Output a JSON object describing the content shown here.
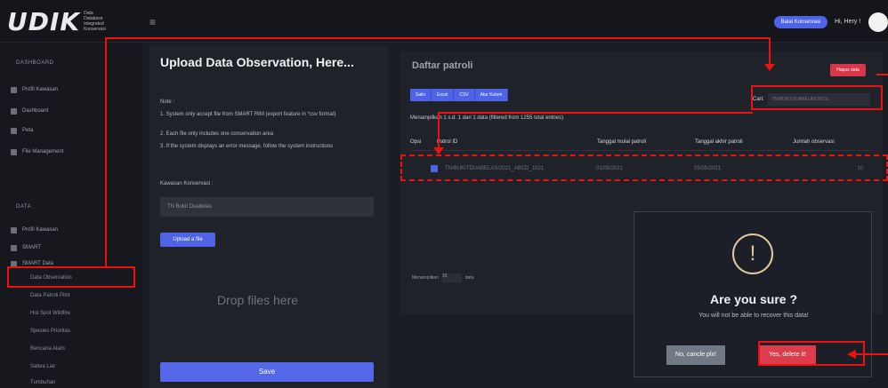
{
  "topbar": {
    "logo": "UDIK",
    "logo_sub": "Data Database Integrated Konservasi",
    "hamburger": "≡",
    "pill": "Balai Konservasi",
    "greeting": "Hi, Hery !"
  },
  "sidebar": {
    "sections": [
      {
        "head": "DASHBOARD",
        "items": [
          "Profil Kawasan",
          "Dashboard",
          "Peta",
          "File Management"
        ]
      },
      {
        "head": "DATA",
        "items": [
          "Profil Kawasan",
          "SMART",
          "SMART Data"
        ]
      }
    ],
    "sub_items": [
      "Data Observation",
      "Data Patroli Pilot",
      "Hot Spot Wildfire",
      "Spesies Prioritas",
      "Bencana Alam",
      "Satwa Liar",
      "Tumbuhan"
    ]
  },
  "upload": {
    "title": "Upload Data Observation, Here...",
    "note_label": "Note :",
    "notes": [
      "1. System only accept file from SMART RIM (export feature in *csv format)",
      "2. Each file only includes one conservation area",
      "3. If the system displays an error message, follow the system instructions"
    ],
    "field_label": "Kawasan Konservasi :",
    "select_value": "TN Bukit Duabelas",
    "btn": "Upload a file",
    "drop": "Drop files here",
    "save": "Save"
  },
  "list": {
    "title": "Daftar patroli",
    "tools": [
      "Salin",
      "Excel",
      "CSV",
      "Atur Kolom"
    ],
    "red_btn": "Hapus data",
    "search_label": "Cari:",
    "search_placeholder": "TN/BUKITDUABELAS/2021/...",
    "info": "Menampilkan 1 s.d. 1 dari 1 data (filtered from 1255 total entries)",
    "columns": [
      "Opsi",
      "Patrol ID",
      "Tanggal mulai patroli",
      "Tanggal akhir patroli",
      "Jumlah observasi"
    ],
    "row": [
      "",
      "TN/BUKITDUABELAS/2021_ABCD_1021",
      "01/05/2021",
      "05/05/2021",
      "10"
    ],
    "length_label": "Menampilkan",
    "length_value": "10",
    "length_suffix": "data"
  },
  "modal": {
    "icon": "!",
    "title": "Are you sure ?",
    "text": "You will not be able to recover this data!",
    "cancel": "No, cancle plx!",
    "confirm": "Yes, delete it!"
  },
  "colors": {
    "accent": "#4f63e6",
    "danger": "#dd3c4c",
    "annotation": "#ee1111"
  }
}
